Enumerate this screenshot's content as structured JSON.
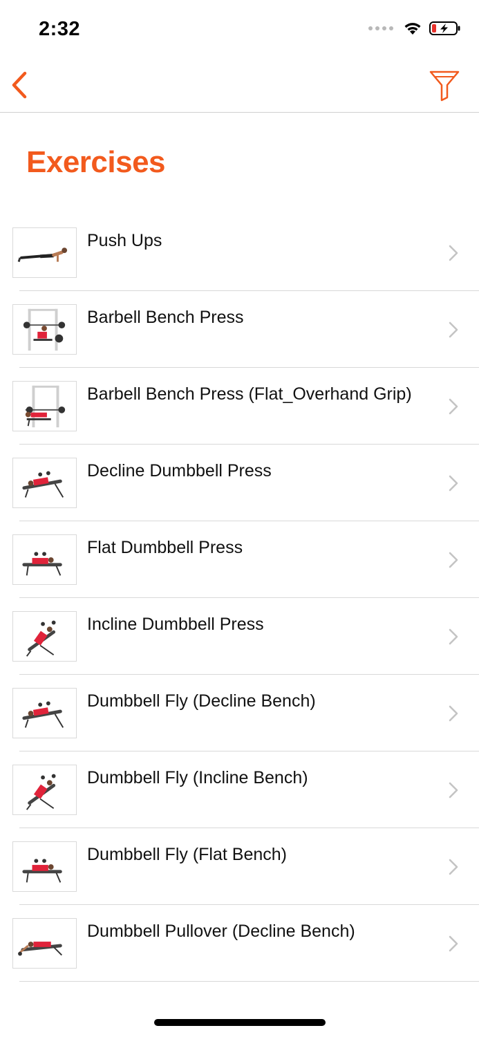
{
  "status_bar": {
    "time": "2:32"
  },
  "nav": {
    "back_icon": "chevron-left-icon",
    "filter_icon": "filter-icon",
    "accent_color": "#f25a1d"
  },
  "page": {
    "title": "Exercises"
  },
  "exercises": [
    {
      "name": "Push Ups",
      "thumb": "pushup"
    },
    {
      "name": "Barbell Bench Press",
      "thumb": "rack-incline"
    },
    {
      "name": "Barbell Bench Press (Flat_Overhand Grip)",
      "thumb": "rack-flat"
    },
    {
      "name": "Decline Dumbbell Press",
      "thumb": "decline"
    },
    {
      "name": "Flat Dumbbell Press",
      "thumb": "flat"
    },
    {
      "name": "Incline Dumbbell Press",
      "thumb": "incline"
    },
    {
      "name": "Dumbbell Fly (Decline Bench)",
      "thumb": "decline"
    },
    {
      "name": "Dumbbell Fly (Incline Bench)",
      "thumb": "incline"
    },
    {
      "name": "Dumbbell Fly (Flat Bench)",
      "thumb": "flat"
    },
    {
      "name": "Dumbbell Pullover (Decline Bench)",
      "thumb": "pullover"
    }
  ]
}
